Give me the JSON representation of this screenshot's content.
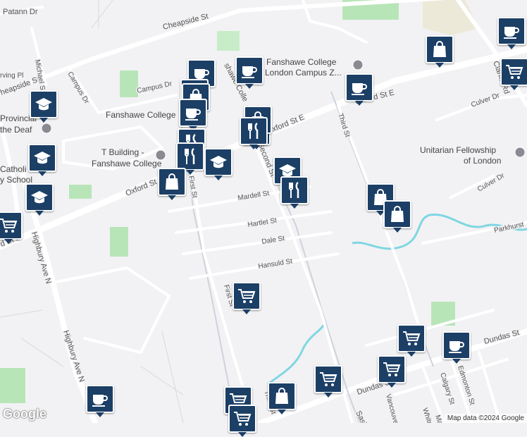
{
  "streets": {
    "cheapside_top": "Cheapside St",
    "cheapside_left": "heapside St",
    "patann": "Patann Dr",
    "michael": "Michael St",
    "irving": "rving Pl",
    "campus_dr_v": "Campus Dr",
    "campus_dr_h": "Campus Dr",
    "oxford_left": "Oxford St",
    "oxford_mid": "Oxford St E",
    "oxford_right": "Oxford St E",
    "oxford_far_left": "d St E",
    "highbury_a": "Highbury Ave N",
    "highbury_b": "Highbury Ave N",
    "first_a": "First St",
    "first_b": "First St",
    "second": "Second St",
    "third_a": "Third St",
    "third_b": "Third St",
    "mardell": "Mardell St",
    "hartlet": "Hartlet St",
    "dale": "Dale St",
    "hansuld": "Hansuld St",
    "culver_a": "Culver Dr",
    "culver_b": "Culver Dr",
    "clarke": "Clarke Rd",
    "parkhurst": "Parkhurst",
    "dundas_a": "Dundas St",
    "dundas_b": "Dundas St",
    "saskatoon": "Saskatoo",
    "vancouver": "Vancouver",
    "whitney": "Whitney St",
    "calgary": "Calgary St",
    "edmonton": "Edmonton St",
    "ma": "Ma",
    "fawe_college_label": "Fanshawe College"
  },
  "places": {
    "fanshawe_college": "Fanshawe College",
    "fanshawe_zone_a": "Fanshawe College",
    "fanshawe_zone_b": "London Campus Z...",
    "t_building_a": "T Building -",
    "t_building_b": "Fanshawe College",
    "unitarian_a": "Unitarian Fellowship",
    "unitarian_b": "of London",
    "provincial_a": "Provincial",
    "provincial_b": "the Deaf",
    "catholic_a": "Catholi",
    "catholic_b": "y School",
    "shawe_coll": "shawe Colle"
  },
  "attribution": {
    "logo": "Google",
    "text": "Map data ©2024 Google"
  },
  "colors": {
    "pin": "#1c3f66",
    "park": "#b8e5b8",
    "water": "#7fd6e2",
    "road": "#ffffff",
    "bg": "#f2f2f4"
  },
  "pins": [
    {
      "name": "bag-pin-top-right",
      "icon": "shopping-bag-icon"
    },
    {
      "name": "coffee-pin-top-right",
      "icon": "coffee-cup-icon"
    },
    {
      "name": "cart-pin-clarke",
      "icon": "shopping-cart-icon"
    },
    {
      "name": "coffee-pin-fanshawe-zone",
      "icon": "coffee-cup-icon"
    },
    {
      "name": "coffee-pin-oxford",
      "icon": "coffee-cup-icon"
    },
    {
      "name": "coffee-pin-campus-1",
      "icon": "coffee-cup-icon"
    },
    {
      "name": "coffee-pin-campus-2",
      "icon": "coffee-cup-icon"
    },
    {
      "name": "bag-pin-campus",
      "icon": "shopping-bag-icon"
    },
    {
      "name": "coffee-pin-campus-3",
      "icon": "coffee-cup-icon"
    },
    {
      "name": "fork-pin-campus-1",
      "icon": "fork-knife-icon"
    },
    {
      "name": "bag-pin-second",
      "icon": "shopping-bag-icon"
    },
    {
      "name": "fork-pin-second",
      "icon": "fork-knife-icon"
    },
    {
      "name": "fork-pin-campus-2",
      "icon": "fork-knife-icon"
    },
    {
      "name": "fork-pin-campus-3",
      "icon": "fork-knife-icon"
    },
    {
      "name": "grad-pin-t-building",
      "icon": "graduation-cap-icon"
    },
    {
      "name": "bag-pin-t-building",
      "icon": "shopping-bag-icon"
    },
    {
      "name": "grad-pin-mardell",
      "icon": "graduation-cap-icon"
    },
    {
      "name": "fork-pin-mardell",
      "icon": "fork-knife-icon"
    },
    {
      "name": "grad-pin-provincial",
      "icon": "graduation-cap-icon"
    },
    {
      "name": "grad-pin-catholic",
      "icon": "graduation-cap-icon"
    },
    {
      "name": "grad-pin-left",
      "icon": "graduation-cap-icon"
    },
    {
      "name": "cart-pin-left-edge",
      "icon": "shopping-cart-icon"
    },
    {
      "name": "bag-pin-third-1",
      "icon": "shopping-bag-icon"
    },
    {
      "name": "bag-pin-third-2",
      "icon": "shopping-bag-icon"
    },
    {
      "name": "cart-pin-first",
      "icon": "shopping-cart-icon"
    },
    {
      "name": "cart-pin-dundas-1",
      "icon": "shopping-cart-icon"
    },
    {
      "name": "coffee-pin-dundas",
      "icon": "coffee-cup-icon"
    },
    {
      "name": "cart-pin-dundas-2",
      "icon": "shopping-cart-icon"
    },
    {
      "name": "cart-pin-dundas-3",
      "icon": "shopping-cart-icon"
    },
    {
      "name": "bag-pin-bottom",
      "icon": "shopping-bag-icon"
    },
    {
      "name": "coffee-pin-bottom-left",
      "icon": "coffee-cup-icon"
    },
    {
      "name": "cart-pin-bottom-1",
      "icon": "shopping-cart-icon"
    },
    {
      "name": "cart-pin-bottom-2",
      "icon": "shopping-cart-icon"
    }
  ]
}
